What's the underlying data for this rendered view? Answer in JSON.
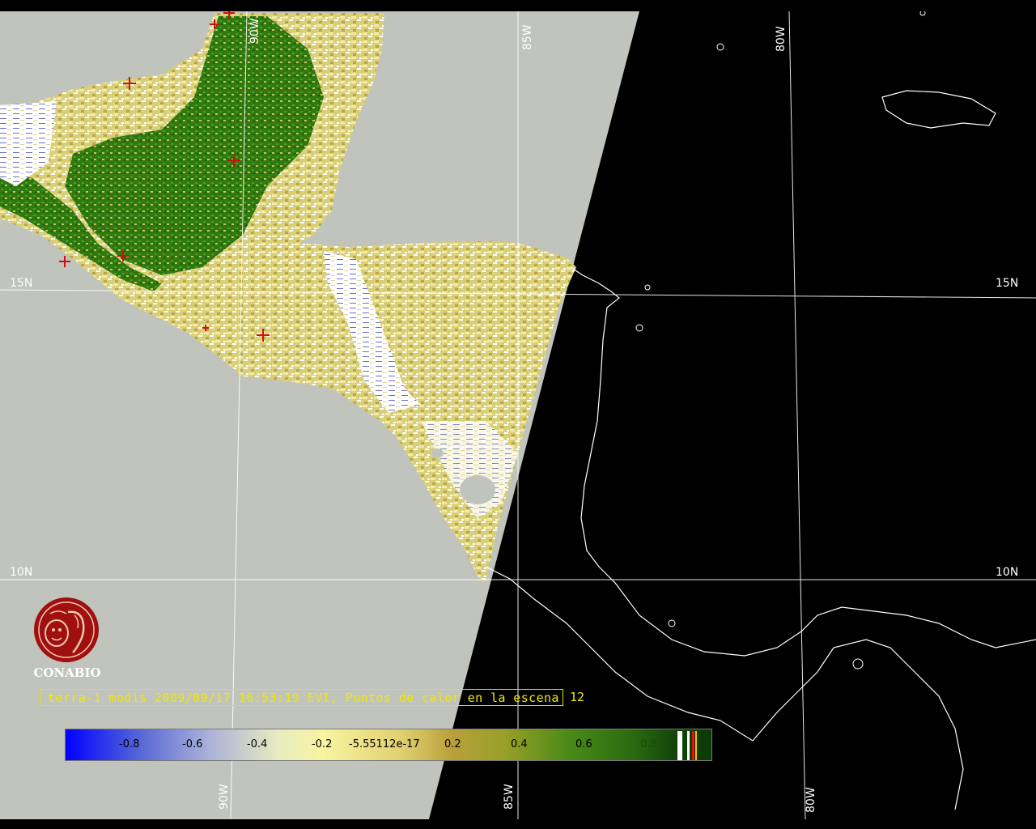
{
  "map": {
    "grid_labels": {
      "lat_15_left": "15N",
      "lat_15_right": "15N",
      "lat_10_left": "10N",
      "lat_10_right": "10N",
      "lon_90_top": "90W",
      "lon_85_top": "85W",
      "lon_80_top": "80W",
      "lon_90_bottom": "90W",
      "lon_85_bottom": "85W",
      "lon_80_bottom": "80W"
    },
    "colors": {
      "swath_background": "#c0c4bc",
      "night_background": "#000000",
      "grid_lines": "#ffffff",
      "coastline": "#ffffff",
      "hotspot_marker": "#d01010",
      "vegetation_high": "#2f7a12",
      "vegetation_low": "#e6dc88",
      "bare": "#ffffff"
    }
  },
  "logo": {
    "text": "CONABIO",
    "color": "#a01010"
  },
  "caption": {
    "text": "terra-1 modis 2009/09/17 16:53:19 EVI, Puntos de calor en la escena",
    "count": "12",
    "color": "#f0e800"
  },
  "colorbar": {
    "labels": [
      "-0.8",
      "-0.6",
      "-0.4",
      "-0.2",
      "-5.55112e-17",
      "0.2",
      "0.4",
      "0.6",
      "0.8"
    ],
    "stripe_colors": [
      "#ffffff",
      "#ffffff",
      "#e01010",
      "#f0c000"
    ]
  }
}
